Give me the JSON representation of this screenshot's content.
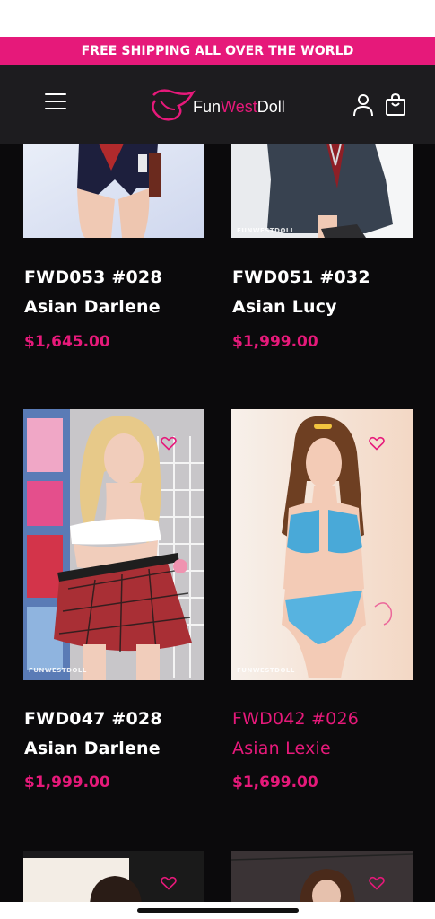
{
  "promo": {
    "text": "FREE SHIPPING ALL OVER THE WORLD"
  },
  "header": {
    "logo": {
      "part1": "Fun",
      "part2": "West",
      "part3": "Doll"
    },
    "icons": [
      "menu-icon",
      "account-icon",
      "cart-icon"
    ]
  },
  "products": [
    {
      "name": "FWD053 #028",
      "sub": "Asian Darlene",
      "price": "$1,645.00",
      "watermark": ""
    },
    {
      "name": "FWD051 #032",
      "sub": "Asian Lucy",
      "price": "$1,999.00",
      "watermark": "FUNWESTDOLL"
    },
    {
      "name": "FWD047 #028",
      "sub": "Asian Darlene",
      "price": "$1,999.00",
      "watermark": "FUNWESTDOLL"
    },
    {
      "name": "FWD042 #026",
      "sub": "Asian Lexie",
      "price": "$1,699.00",
      "watermark": "FUNWESTDOLL"
    }
  ],
  "colors": {
    "accent": "#e6197a",
    "background": "#0b0a0c",
    "header": "#1d1c1f"
  }
}
